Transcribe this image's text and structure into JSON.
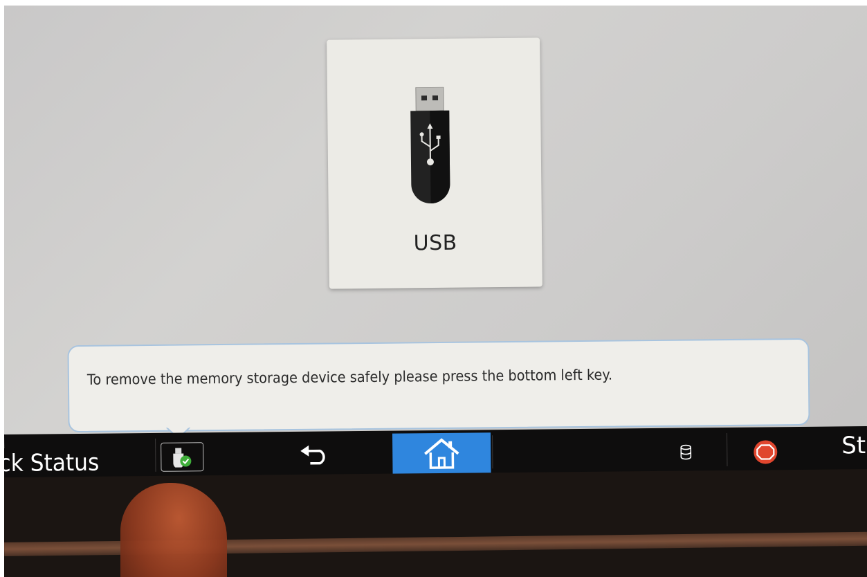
{
  "usb_tile": {
    "label": "USB",
    "icon": "usb-drive-icon"
  },
  "notification": {
    "message": "To remove the memory storage device safely please press the bottom left key."
  },
  "taskbar": {
    "left_label": "ck Status",
    "eject_icon": "usb-eject-check-icon",
    "back_icon": "back-arrow-icon",
    "home_icon": "home-icon",
    "storage_icon": "storage-cylinder-icon",
    "stop_icon": "stop-icon",
    "right_label": "St"
  },
  "colors": {
    "home_active": "#2f86de",
    "stop_red": "#e0462e",
    "check_green": "#3fae3a",
    "toast_border": "#a8c4df"
  }
}
